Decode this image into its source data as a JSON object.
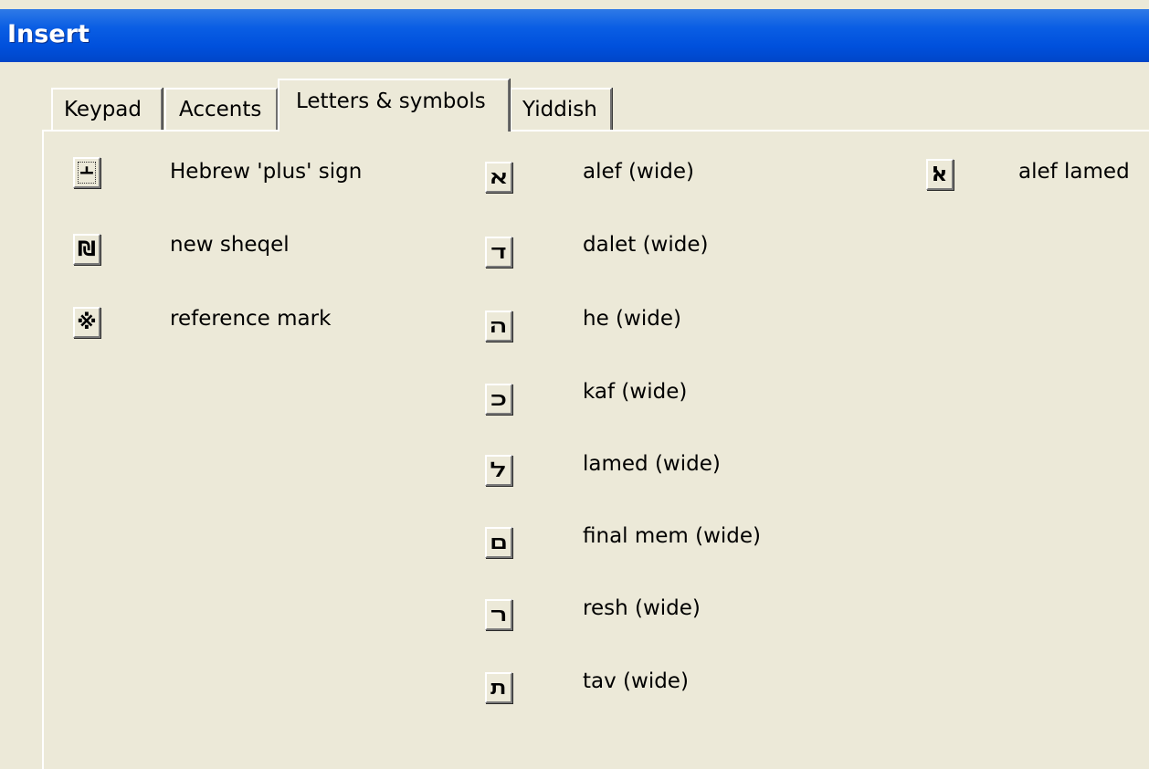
{
  "window": {
    "title": "Insert"
  },
  "tabs": [
    {
      "label": "Keypad",
      "active": false
    },
    {
      "label": "Accents",
      "active": false
    },
    {
      "label": "Letters & symbols",
      "active": true
    },
    {
      "label": "Yiddish",
      "active": false
    }
  ],
  "symbols": {
    "column1": [
      {
        "glyph": "﬩",
        "label": "Hebrew 'plus' sign",
        "icon": "hebrew-plus-icon"
      },
      {
        "glyph": "₪",
        "label": "new sheqel",
        "icon": "sheqel-icon"
      },
      {
        "glyph": "※",
        "label": "reference mark",
        "icon": "reference-mark-icon"
      }
    ],
    "column2": [
      {
        "glyph": "ﬡ",
        "label": "alef (wide)",
        "icon": "alef-wide-icon"
      },
      {
        "glyph": "ﬢ",
        "label": "dalet (wide)",
        "icon": "dalet-wide-icon"
      },
      {
        "glyph": "ﬣ",
        "label": "he (wide)",
        "icon": "he-wide-icon"
      },
      {
        "glyph": "ﬤ",
        "label": "kaf (wide)",
        "icon": "kaf-wide-icon"
      },
      {
        "glyph": "ﬥ",
        "label": "lamed (wide)",
        "icon": "lamed-wide-icon"
      },
      {
        "glyph": "ﬦ",
        "label": "final mem (wide)",
        "icon": "final-mem-wide-icon"
      },
      {
        "glyph": "ﬧ",
        "label": "resh (wide)",
        "icon": "resh-wide-icon"
      },
      {
        "glyph": "ﬨ",
        "label": "tav (wide)",
        "icon": "tav-wide-icon"
      }
    ],
    "column3": [
      {
        "glyph": "ﭏ",
        "label": "alef lamed",
        "icon": "alef-lamed-icon"
      }
    ]
  }
}
